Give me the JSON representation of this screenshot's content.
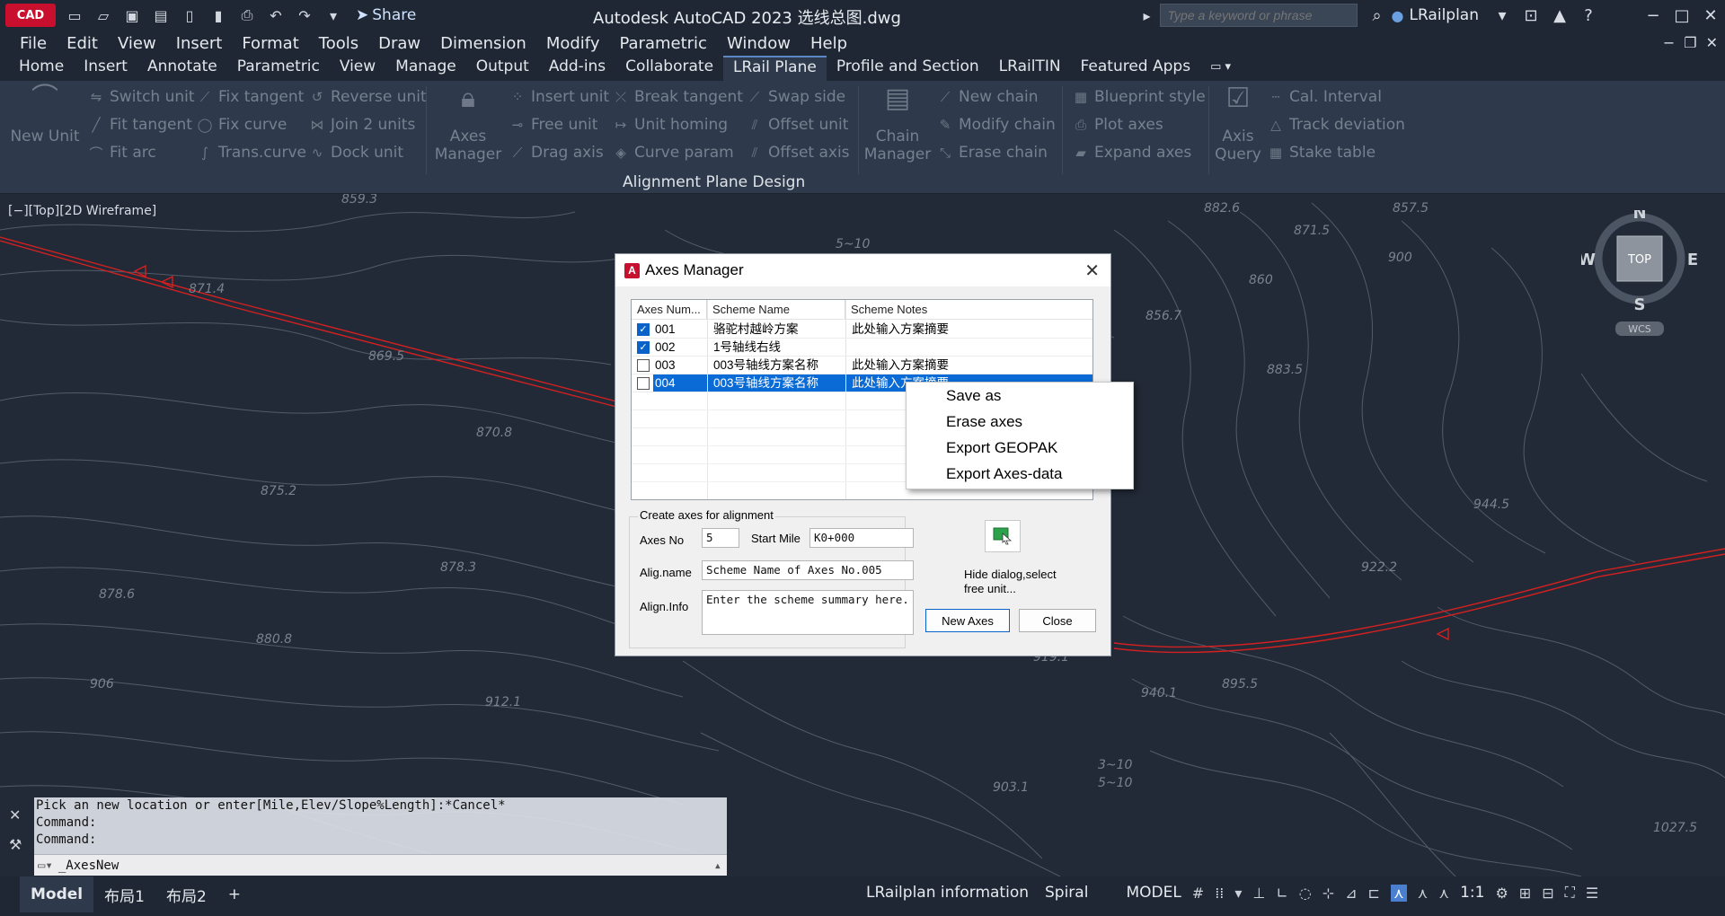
{
  "titlebar": {
    "logo": "CAD",
    "share_label": "Share",
    "title": "Autodesk AutoCAD 2023    选线总图.dwg",
    "search_placeholder": "Type a keyword or phrase",
    "user": "LRailplan"
  },
  "menu": [
    "File",
    "Edit",
    "View",
    "Insert",
    "Format",
    "Tools",
    "Draw",
    "Dimension",
    "Modify",
    "Parametric",
    "Window",
    "Help"
  ],
  "ribbon_tabs": [
    "Home",
    "Insert",
    "Annotate",
    "Parametric",
    "View",
    "Manage",
    "Output",
    "Add-ins",
    "Collaborate",
    "LRail Plane",
    "Profile and Section",
    "LRailTIN",
    "Featured Apps"
  ],
  "ribbon_active_tab": "LRail Plane",
  "ribbon": {
    "new_unit": "New Unit",
    "col1": [
      "Switch unit",
      "Fit tangent",
      "Fit arc"
    ],
    "col2": [
      "Fix tangent",
      "Fix curve",
      "Trans.curve"
    ],
    "col3": [
      "Reverse unit",
      "Join 2 units",
      "Dock unit"
    ],
    "axes_manager": [
      "Axes",
      "Manager"
    ],
    "col4": [
      "Insert unit",
      "Free unit",
      "Drag axis"
    ],
    "col5": [
      "Break tangent",
      "Unit homing",
      "Curve param"
    ],
    "col6": [
      "Swap side",
      "Offset unit",
      "Offset axis"
    ],
    "chain_manager": [
      "Chain",
      "Manager"
    ],
    "col7": [
      "New chain",
      "Modify chain",
      "Erase chain"
    ],
    "col8": [
      "Blueprint style",
      "Plot axes",
      "Expand axes"
    ],
    "axis_query": [
      "Axis",
      "Query"
    ],
    "col9": [
      "Cal. Interval",
      "Track deviation",
      "Stake table"
    ],
    "panel_title": "Alignment Plane Design"
  },
  "viewport": {
    "label": "[−][Top][2D Wireframe]",
    "compass": {
      "n": "N",
      "s": "S",
      "e": "E",
      "w": "W",
      "top": "TOP",
      "wcs": "WCS"
    },
    "contour_labels": [
      "859.3",
      "871.4",
      "869.5",
      "870.8",
      "875.2",
      "878.3",
      "878.6",
      "880.8",
      "900",
      "882.6",
      "871.5",
      "857.5",
      "860",
      "856.7",
      "5~10",
      "3~10",
      "5~10",
      "903.1",
      "944.5",
      "922.2",
      "1027.5",
      "912.1",
      "906",
      "895.5",
      "919.1",
      "940.1",
      "883.5"
    ]
  },
  "dialog": {
    "title": "Axes Manager",
    "columns": [
      "Axes Num...",
      "Scheme Name",
      "Scheme Notes"
    ],
    "rows": [
      {
        "checked": true,
        "num": "001",
        "name": "骆驼村越岭方案",
        "notes": "此处输入方案摘要",
        "selected": false
      },
      {
        "checked": true,
        "num": "002",
        "name": "1号轴线右线",
        "notes": "",
        "selected": false
      },
      {
        "checked": false,
        "num": "003",
        "name": "003号轴线方案名称",
        "notes": "此处输入方案摘要",
        "selected": false
      },
      {
        "checked": false,
        "num": "004",
        "name": "003号轴线方案名称",
        "notes": "此处输入方案摘要",
        "selected": true
      }
    ],
    "create_group": "Create axes for alignment",
    "axes_no_label": "Axes No",
    "axes_no_value": "5",
    "start_mile_label": "Start Mile",
    "start_mile_value": "K0+000",
    "align_name_label": "Alig.name",
    "align_name_value": "Scheme Name of Axes No.005",
    "align_info_label": "Align.Info",
    "align_info_value": "Enter the scheme summary here.",
    "hide_text_1": "Hide dialog,select",
    "hide_text_2": "free unit...",
    "new_axes_button": "New Axes",
    "close_button": "Close"
  },
  "context_menu": [
    "Save as",
    "Erase axes",
    "Export GEOPAK",
    "Export Axes-data"
  ],
  "command": {
    "lines": [
      "Pick an new location or enter[Mile,Elev/Slope%Length]:*Cancel*",
      "Command:",
      "Command:"
    ],
    "input": "_AxesNew"
  },
  "statusbar": {
    "layouts": [
      "Model",
      "布局1",
      "布局2"
    ],
    "info": "LRailplan  information",
    "spiral": "Spiral",
    "model": "MODEL",
    "scale": "1:1"
  },
  "colors": {
    "alignment": "#d42020",
    "selection": "#0a6bd6",
    "contour": "#6b7280"
  }
}
